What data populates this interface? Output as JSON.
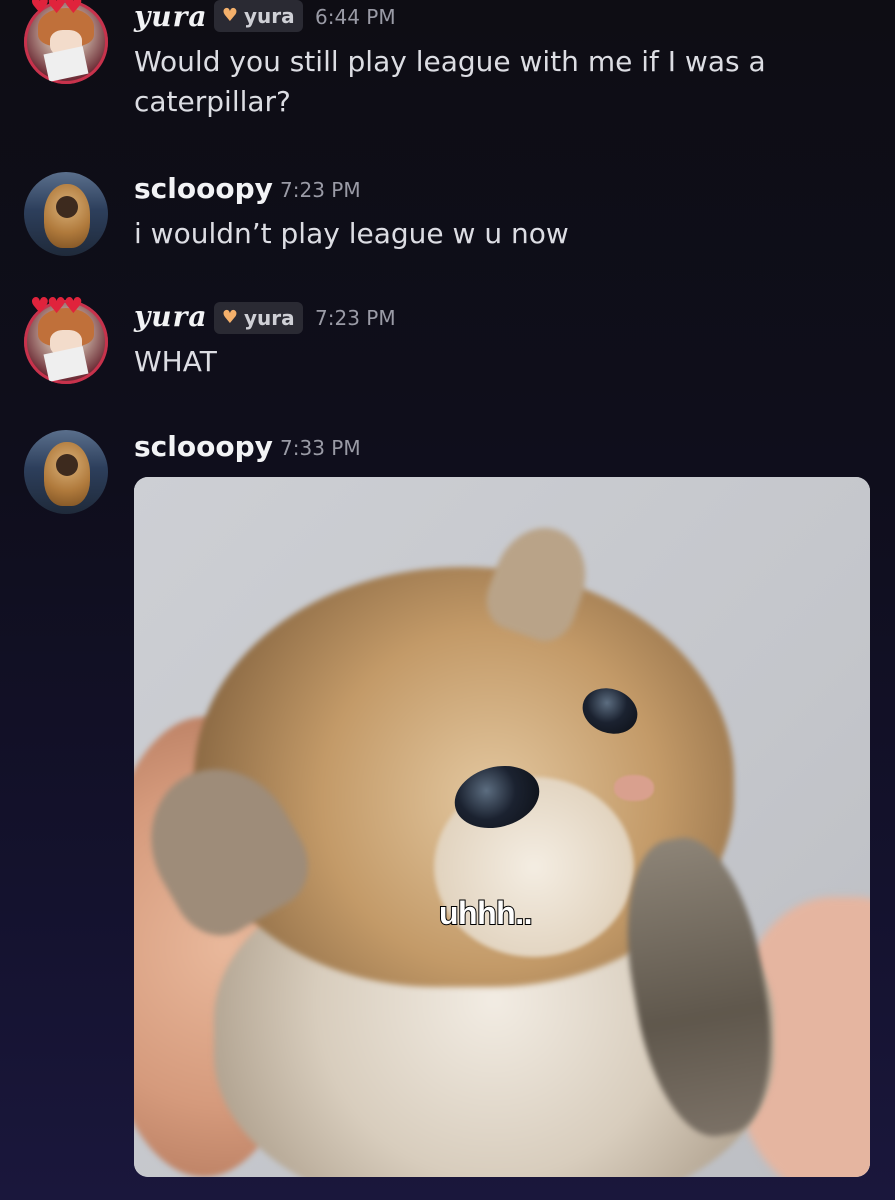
{
  "messages": [
    {
      "username": "yura",
      "tag": {
        "icon": "heart-badge-icon",
        "label": "yura"
      },
      "time": "6:44 PM",
      "text": "Would you still play league with me if I was a caterpillar?"
    },
    {
      "username": "sclooopy",
      "time": "7:23 PM",
      "text": "i wouldn’t play league w u now"
    },
    {
      "username": "yura",
      "tag": {
        "icon": "heart-badge-icon",
        "label": "yura"
      },
      "time": "7:23 PM",
      "text": "WHAT"
    },
    {
      "username": "sclooopy",
      "time": "7:33 PM",
      "attachment": {
        "type": "image",
        "caption": "uhhh.."
      }
    }
  ],
  "colors": {
    "background_top": "#0e0d14",
    "background_bottom": "#1a173c",
    "username": "#f2f3f5",
    "timestamp": "#9a9ba6",
    "message_text": "#dcdde3",
    "tag_background": "#2a2a33",
    "tag_icon": "#f4b06b",
    "heart_decoration": "#e0233c"
  },
  "decorations": {
    "avatar_hearts": "♥♥♥"
  }
}
